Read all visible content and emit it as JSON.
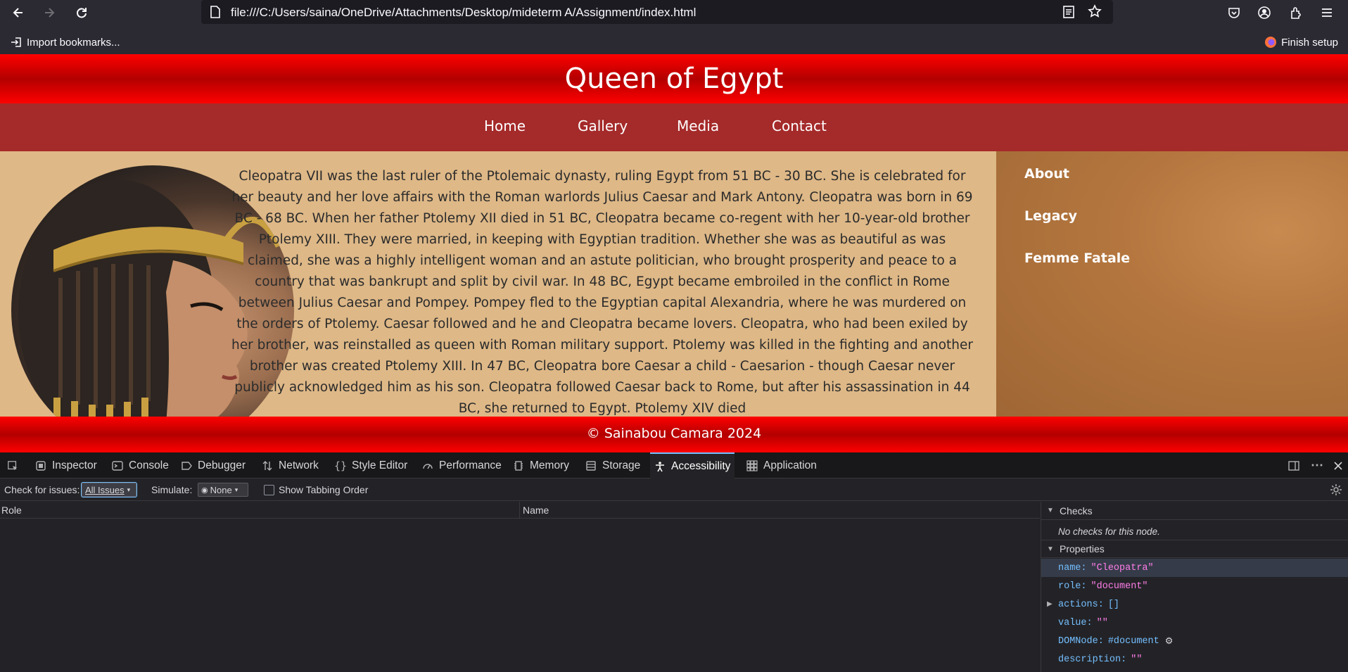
{
  "browser": {
    "url": "file:///C:/Users/saina/OneDrive/Attachments/Desktop/mideterm A/Assignment/index.html",
    "bookmarks_import": "Import bookmarks...",
    "finish_setup": "Finish setup"
  },
  "site": {
    "title": "Queen of Egypt",
    "nav": [
      "Home",
      "Gallery",
      "Media",
      "Contact"
    ],
    "article": "Cleopatra VII was the last ruler of the Ptolemaic dynasty, ruling Egypt from 51 BC - 30 BC. She is celebrated for her beauty and her love affairs with the Roman warlords Julius Caesar and Mark Antony. Cleopatra was born in 69 BC - 68 BC. When her father Ptolemy XII died in 51 BC, Cleopatra became co-regent with her 10-year-old brother Ptolemy XIII. They were married, in keeping with Egyptian tradition. Whether she was as beautiful as was claimed, she was a highly intelligent woman and an astute politician, who brought prosperity and peace to a country that was bankrupt and split by civil war. In 48 BC, Egypt became embroiled in the conflict in Rome between Julius Caesar and Pompey. Pompey fled to the Egyptian capital Alexandria, where he was murdered on the orders of Ptolemy. Caesar followed and he and Cleopatra became lovers. Cleopatra, who had been exiled by her brother, was reinstalled as queen with Roman military support. Ptolemy was killed in the fighting and another brother was created Ptolemy XIII. In 47 BC, Cleopatra bore Caesar a child - Caesarion - though Caesar never publicly acknowledged him as his son. Cleopatra followed Caesar back to Rome, but after his assassination in 44 BC, she returned to Egypt. Ptolemy XIV died",
    "aside_links": [
      "About",
      "Legacy",
      "Femme Fatale"
    ],
    "footer": "© Sainabou Camara 2024"
  },
  "devtools": {
    "tabs": [
      "Inspector",
      "Console",
      "Debugger",
      "Network",
      "Style Editor",
      "Performance",
      "Memory",
      "Storage",
      "Accessibility",
      "Application"
    ],
    "selected_tab": "Accessibility",
    "check_label": "Check for issues:",
    "check_value": "All Issues",
    "simulate_label": "Simulate:",
    "simulate_value": "None",
    "tabbing_label": "Show Tabbing Order",
    "columns": [
      "Role",
      "Name"
    ],
    "checks_heading": "Checks",
    "checks_empty": "No checks for this node.",
    "properties_heading": "Properties",
    "properties": [
      {
        "key": "name:",
        "value": "\"Cleopatra\""
      },
      {
        "key": "role:",
        "value": "\"document\""
      },
      {
        "key": "actions:",
        "value": "[]"
      },
      {
        "key": "value:",
        "value": "\"\""
      },
      {
        "key": "DOMNode:",
        "value": "#document"
      },
      {
        "key": "description:",
        "value": "\"\""
      }
    ]
  }
}
